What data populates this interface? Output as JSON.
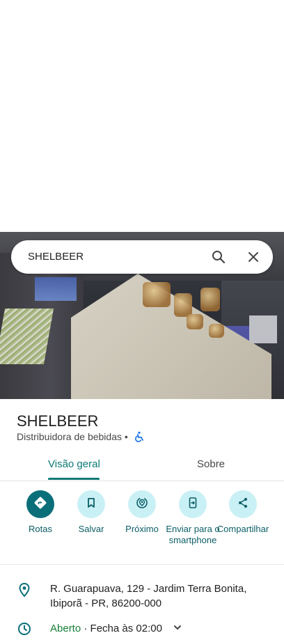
{
  "search": {
    "query": "SHELBEER"
  },
  "place": {
    "name": "SHELBEER",
    "category": "Distribuidora de bebidas •"
  },
  "tabs": [
    {
      "label": "Visão geral",
      "active": true
    },
    {
      "label": "Sobre",
      "active": false
    }
  ],
  "actions": {
    "rotas": "Rotas",
    "salvar": "Salvar",
    "proximo": "Próximo",
    "enviar": "Enviar para o smartphone",
    "compartilhar": "Compartilhar"
  },
  "details": {
    "address": "R. Guarapuava, 129 - Jardim Terra Bonita, Ibiporã - PR, 86200-000",
    "hours_status": "Aberto",
    "hours_close": " · Fecha às 02:00"
  },
  "colors": {
    "accent": "#0b7a75",
    "action_bg": "#c9f0f5",
    "primary_action": "#0b6f79",
    "open_green": "#188038"
  },
  "icons": [
    "search-icon",
    "close-icon",
    "accessibility-icon",
    "directions-icon",
    "bookmark-icon",
    "nearby-icon",
    "send-to-phone-icon",
    "share-icon",
    "location-pin-icon",
    "clock-icon",
    "chevron-down-icon"
  ]
}
